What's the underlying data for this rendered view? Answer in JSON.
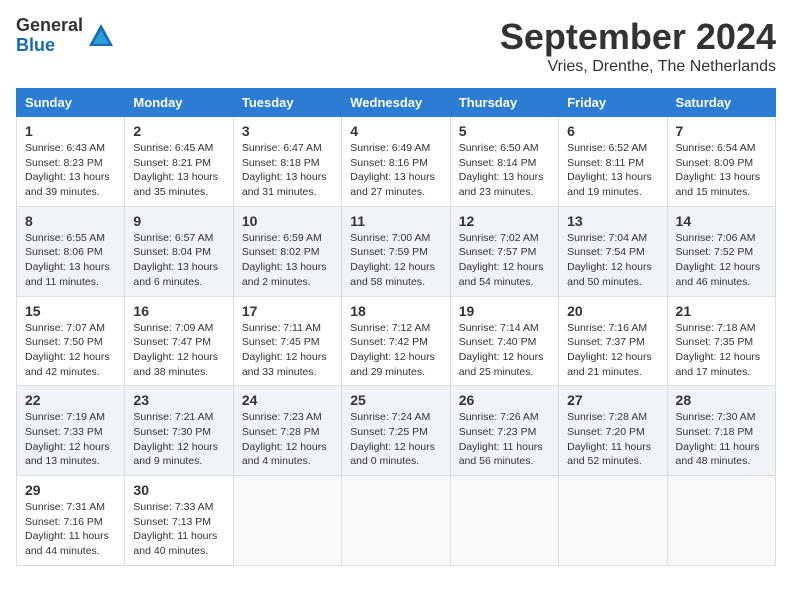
{
  "logo": {
    "general": "General",
    "blue": "Blue"
  },
  "header": {
    "title": "September 2024",
    "subtitle": "Vries, Drenthe, The Netherlands"
  },
  "columns": [
    "Sunday",
    "Monday",
    "Tuesday",
    "Wednesday",
    "Thursday",
    "Friday",
    "Saturday"
  ],
  "weeks": [
    [
      {
        "day": "1",
        "info": "Sunrise: 6:43 AM\nSunset: 8:23 PM\nDaylight: 13 hours\nand 39 minutes."
      },
      {
        "day": "2",
        "info": "Sunrise: 6:45 AM\nSunset: 8:21 PM\nDaylight: 13 hours\nand 35 minutes."
      },
      {
        "day": "3",
        "info": "Sunrise: 6:47 AM\nSunset: 8:18 PM\nDaylight: 13 hours\nand 31 minutes."
      },
      {
        "day": "4",
        "info": "Sunrise: 6:49 AM\nSunset: 8:16 PM\nDaylight: 13 hours\nand 27 minutes."
      },
      {
        "day": "5",
        "info": "Sunrise: 6:50 AM\nSunset: 8:14 PM\nDaylight: 13 hours\nand 23 minutes."
      },
      {
        "day": "6",
        "info": "Sunrise: 6:52 AM\nSunset: 8:11 PM\nDaylight: 13 hours\nand 19 minutes."
      },
      {
        "day": "7",
        "info": "Sunrise: 6:54 AM\nSunset: 8:09 PM\nDaylight: 13 hours\nand 15 minutes."
      }
    ],
    [
      {
        "day": "8",
        "info": "Sunrise: 6:55 AM\nSunset: 8:06 PM\nDaylight: 13 hours\nand 11 minutes."
      },
      {
        "day": "9",
        "info": "Sunrise: 6:57 AM\nSunset: 8:04 PM\nDaylight: 13 hours\nand 6 minutes."
      },
      {
        "day": "10",
        "info": "Sunrise: 6:59 AM\nSunset: 8:02 PM\nDaylight: 13 hours\nand 2 minutes."
      },
      {
        "day": "11",
        "info": "Sunrise: 7:00 AM\nSunset: 7:59 PM\nDaylight: 12 hours\nand 58 minutes."
      },
      {
        "day": "12",
        "info": "Sunrise: 7:02 AM\nSunset: 7:57 PM\nDaylight: 12 hours\nand 54 minutes."
      },
      {
        "day": "13",
        "info": "Sunrise: 7:04 AM\nSunset: 7:54 PM\nDaylight: 12 hours\nand 50 minutes."
      },
      {
        "day": "14",
        "info": "Sunrise: 7:06 AM\nSunset: 7:52 PM\nDaylight: 12 hours\nand 46 minutes."
      }
    ],
    [
      {
        "day": "15",
        "info": "Sunrise: 7:07 AM\nSunset: 7:50 PM\nDaylight: 12 hours\nand 42 minutes."
      },
      {
        "day": "16",
        "info": "Sunrise: 7:09 AM\nSunset: 7:47 PM\nDaylight: 12 hours\nand 38 minutes."
      },
      {
        "day": "17",
        "info": "Sunrise: 7:11 AM\nSunset: 7:45 PM\nDaylight: 12 hours\nand 33 minutes."
      },
      {
        "day": "18",
        "info": "Sunrise: 7:12 AM\nSunset: 7:42 PM\nDaylight: 12 hours\nand 29 minutes."
      },
      {
        "day": "19",
        "info": "Sunrise: 7:14 AM\nSunset: 7:40 PM\nDaylight: 12 hours\nand 25 minutes."
      },
      {
        "day": "20",
        "info": "Sunrise: 7:16 AM\nSunset: 7:37 PM\nDaylight: 12 hours\nand 21 minutes."
      },
      {
        "day": "21",
        "info": "Sunrise: 7:18 AM\nSunset: 7:35 PM\nDaylight: 12 hours\nand 17 minutes."
      }
    ],
    [
      {
        "day": "22",
        "info": "Sunrise: 7:19 AM\nSunset: 7:33 PM\nDaylight: 12 hours\nand 13 minutes."
      },
      {
        "day": "23",
        "info": "Sunrise: 7:21 AM\nSunset: 7:30 PM\nDaylight: 12 hours\nand 9 minutes."
      },
      {
        "day": "24",
        "info": "Sunrise: 7:23 AM\nSunset: 7:28 PM\nDaylight: 12 hours\nand 4 minutes."
      },
      {
        "day": "25",
        "info": "Sunrise: 7:24 AM\nSunset: 7:25 PM\nDaylight: 12 hours\nand 0 minutes."
      },
      {
        "day": "26",
        "info": "Sunrise: 7:26 AM\nSunset: 7:23 PM\nDaylight: 11 hours\nand 56 minutes."
      },
      {
        "day": "27",
        "info": "Sunrise: 7:28 AM\nSunset: 7:20 PM\nDaylight: 11 hours\nand 52 minutes."
      },
      {
        "day": "28",
        "info": "Sunrise: 7:30 AM\nSunset: 7:18 PM\nDaylight: 11 hours\nand 48 minutes."
      }
    ],
    [
      {
        "day": "29",
        "info": "Sunrise: 7:31 AM\nSunset: 7:16 PM\nDaylight: 11 hours\nand 44 minutes."
      },
      {
        "day": "30",
        "info": "Sunrise: 7:33 AM\nSunset: 7:13 PM\nDaylight: 11 hours\nand 40 minutes."
      },
      {
        "day": "",
        "info": ""
      },
      {
        "day": "",
        "info": ""
      },
      {
        "day": "",
        "info": ""
      },
      {
        "day": "",
        "info": ""
      },
      {
        "day": "",
        "info": ""
      }
    ]
  ]
}
